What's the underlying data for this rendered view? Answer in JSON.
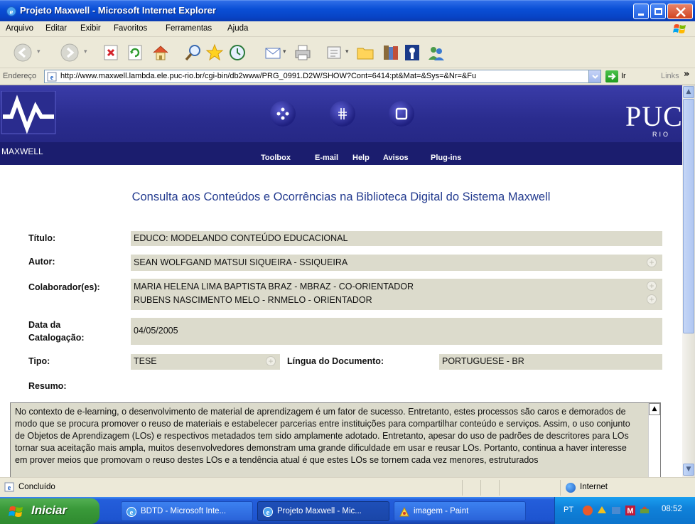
{
  "window": {
    "title": "Projeto Maxwell - Microsoft Internet Explorer"
  },
  "menu": [
    "Arquivo",
    "Editar",
    "Exibir",
    "Favoritos",
    "Ferramentas",
    "Ajuda"
  ],
  "address": {
    "label": "Endereço",
    "url": "http://www.maxwell.lambda.ele.puc-rio.br/cgi-bin/db2www/PRG_0991.D2W/SHOW?Cont=6414:pt&Mat=&Sys=&Nr=&Fu",
    "go_label": "Ir",
    "links_label": "Links",
    "links_chevron": "»"
  },
  "banner": {
    "maxwell_label": "MAXWELL",
    "puc_text": "PUC",
    "rio_text": "RIO",
    "nav": [
      "Toolbox",
      "E-mail",
      "Help",
      "Avisos",
      "Plug-ins"
    ]
  },
  "page": {
    "heading": "Consulta aos Conteúdos e Ocorrências na Biblioteca Digital do Sistema Maxwell",
    "fields": {
      "titulo_label": "Título:",
      "titulo_value": "EDUCO: MODELANDO CONTEÚDO EDUCACIONAL",
      "autor_label": "Autor:",
      "autor_value": "SEAN WOLFGAND MATSUI SIQUEIRA - SSIQUEIRA",
      "colab_label": "Colaborador(es):",
      "colab_values": [
        "MARIA HELENA LIMA BAPTISTA BRAZ - MBRAZ - CO-ORIENTADOR",
        "RUBENS NASCIMENTO MELO - RNMELO - ORIENTADOR"
      ],
      "data_label_1": "Data da",
      "data_label_2": "Catalogação:",
      "data_value": "04/05/2005",
      "tipo_label": "Tipo:",
      "tipo_value": "TESE",
      "lingua_label": "Língua do Documento:",
      "lingua_value": "PORTUGUESE - BR",
      "resumo_label": "Resumo:"
    },
    "abstract": "No contexto de e-learning, o desenvolvimento de material de aprendizagem é um fator de sucesso. Entretanto, estes processos são caros e demorados de modo que se procura promover o reuso de materiais e estabelecer parcerias entre instituições para compartilhar conteúdo e serviços. Assim, o uso conjunto de Objetos de Aprendizagem (LOs) e respectivos metadados tem sido amplamente adotado. Entretanto, apesar do uso de padrões de descritores para LOs tornar sua aceitação mais ampla, muitos desenvolvedores demonstram uma grande dificuldade em usar e reusar LOs. Portanto, continua a haver interesse em prover meios que promovam o reuso destes LOs e a tendência atual é que estes LOs se tornem cada vez menores, estruturados"
  },
  "status": {
    "text": "Concluído",
    "zone": "Internet"
  },
  "taskbar": {
    "start_label": "Iniciar",
    "items": [
      "BDTD - Microsoft Inte...",
      "Projeto Maxwell - Mic...",
      "imagem - Paint"
    ],
    "lang": "PT",
    "clock": "08:52"
  },
  "colors": {
    "banner_blue": "#2a2c8e",
    "heading_blue": "#233b8f",
    "field_bg": "#dcdbcc",
    "xp_title_blue": "#0a4fd6",
    "start_green": "#3a9a3a"
  },
  "icons": [
    "ie-icon",
    "minimize-icon",
    "maximize-icon",
    "close-icon",
    "windows-flag-icon",
    "back-icon",
    "forward-icon",
    "stop-icon",
    "refresh-icon",
    "home-icon",
    "search-icon",
    "favorites-icon",
    "history-icon",
    "mail-icon",
    "print-icon",
    "edit-icon",
    "folder-icon",
    "research-icon",
    "messenger-icon",
    "go-icon",
    "plus-icon",
    "internet-zone-icon"
  ]
}
